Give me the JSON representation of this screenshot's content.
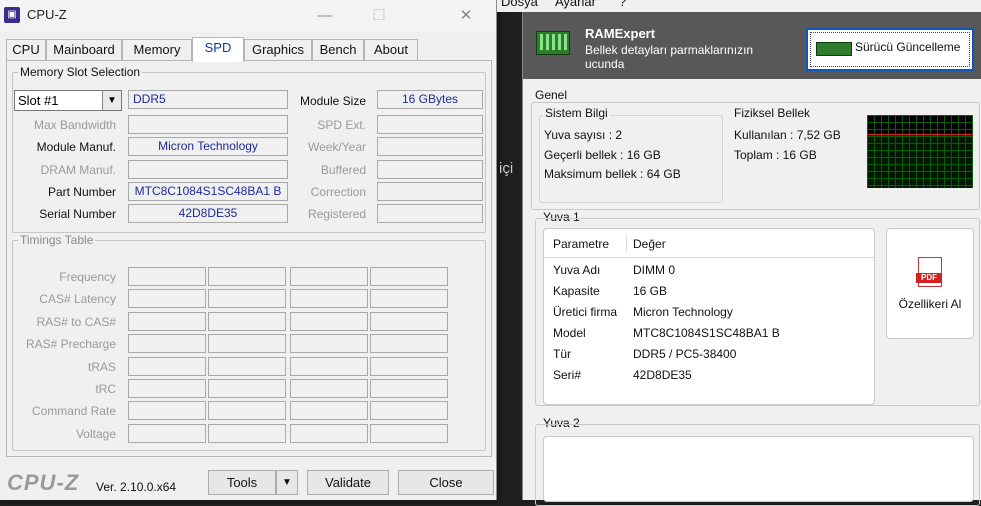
{
  "cpuz": {
    "title": "CPU-Z",
    "tabs": [
      "CPU",
      "Mainboard",
      "Memory",
      "SPD",
      "Graphics",
      "Bench",
      "About"
    ],
    "slot_group": {
      "legend": "Memory Slot Selection",
      "slot_value": "Slot #1",
      "memory_type": "DDR5",
      "module_size_label": "Module Size",
      "module_size_value": "16 GBytes",
      "max_bandwidth_label": "Max Bandwidth",
      "spd_ext_label": "SPD Ext.",
      "module_manuf_label": "Module Manuf.",
      "module_manuf_value": "Micron Technology",
      "week_year_label": "Week/Year",
      "dram_manuf_label": "DRAM Manuf.",
      "buffered_label": "Buffered",
      "part_number_label": "Part Number",
      "part_number_value": "MTC8C1084S1SC48BA1 B",
      "correction_label": "Correction",
      "serial_number_label": "Serial Number",
      "serial_number_value": "42D8DE35",
      "registered_label": "Registered"
    },
    "timings": {
      "legend": "Timings Table",
      "rows": [
        "Frequency",
        "CAS# Latency",
        "RAS# to CAS#",
        "RAS# Precharge",
        "tRAS",
        "tRC",
        "Command Rate",
        "Voltage"
      ]
    },
    "status": {
      "brand": "CPU-Z",
      "version": "Ver. 2.10.0.x64",
      "tools": "Tools",
      "validate": "Validate",
      "close": "Close"
    }
  },
  "background": {
    "menu": [
      "Dosya",
      "Ayarlar",
      "?"
    ],
    "fragment": "içi"
  },
  "ramexpert": {
    "app_name": "RAMExpert",
    "description": "Bellek detayları parmaklarınızın ucunda",
    "driver_button": "Sürücü Güncelleme",
    "general_title": "Genel",
    "system_title": "Sistem Bilgi",
    "slot_count": "Yuva sayısı : 2",
    "valid_memory": "Geçerli bellek : 16 GB",
    "max_memory": "Maksimum bellek : 64 GB",
    "physical_title": "Fiziksel Bellek",
    "used": "Kullanılan : 7,52 GB",
    "total": "Toplam : 16 GB",
    "used_fraction": 0.47,
    "slot1_title": "Yuva 1",
    "table_headers": [
      "Parametre",
      "Değer"
    ],
    "slot1_rows": [
      {
        "param": "Yuva Adı",
        "value": "DIMM 0"
      },
      {
        "param": "Kapasite",
        "value": "16 GB"
      },
      {
        "param": "Üretici firma",
        "value": "Micron Technology"
      },
      {
        "param": "Model",
        "value": "MTC8C1084S1SC48BA1 B"
      },
      {
        "param": "Tür",
        "value": "DDR5 / PC5-38400"
      },
      {
        "param": "Seri#",
        "value": "42D8DE35"
      }
    ],
    "pdf_badge": "PDF",
    "specs_button": "Özellikeri Al",
    "slot2_title": "Yuva 2"
  }
}
